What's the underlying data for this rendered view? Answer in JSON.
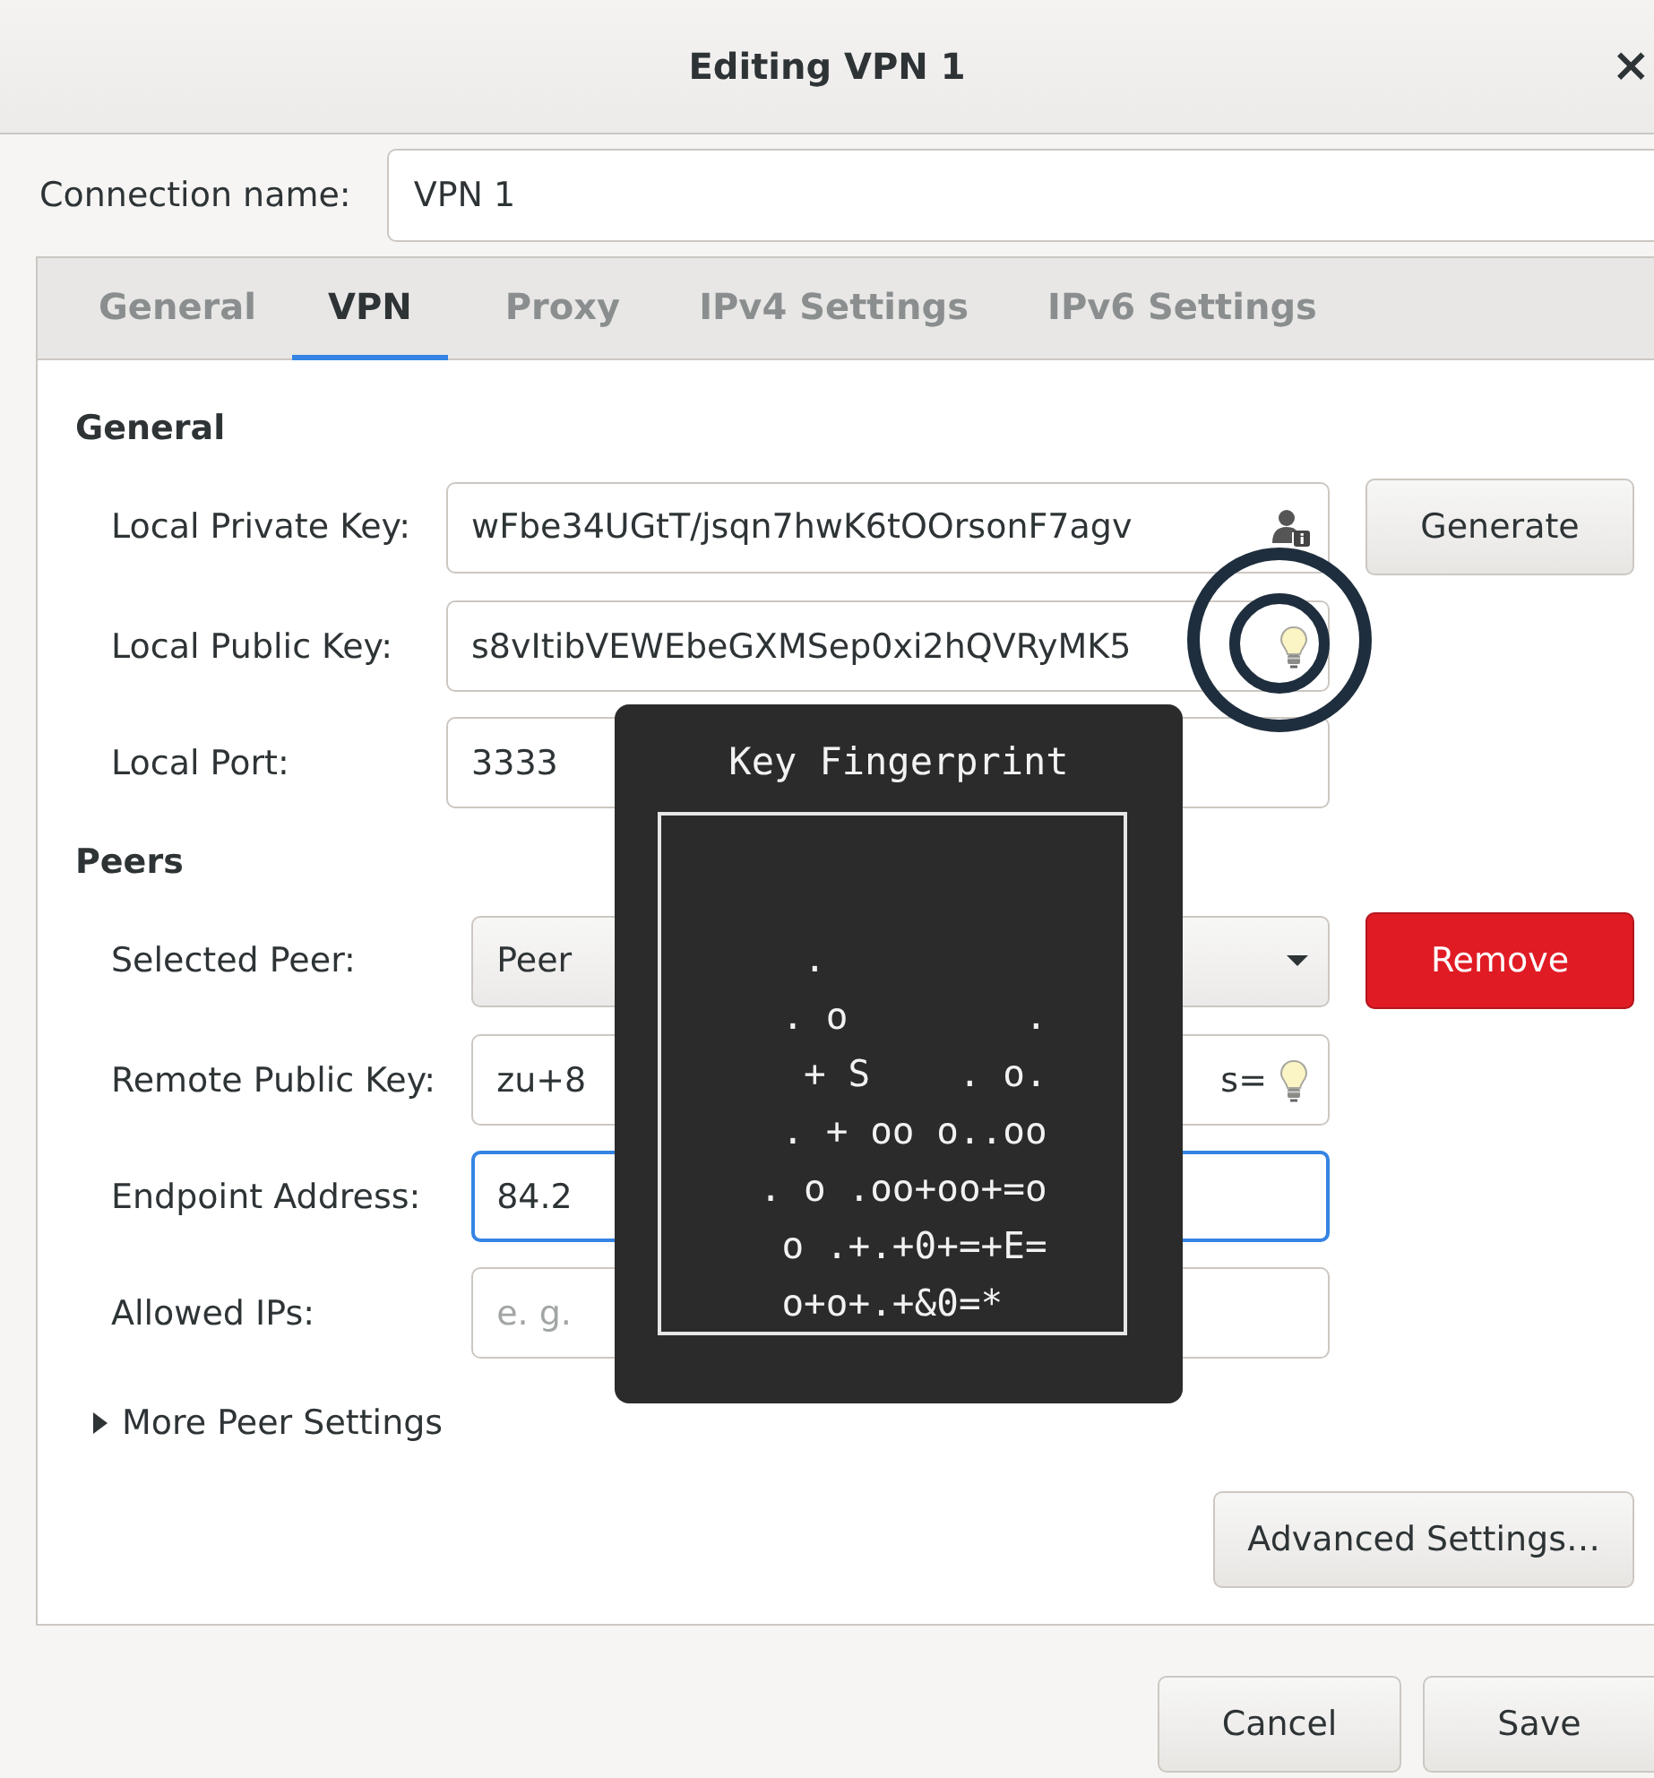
{
  "window": {
    "title": "Editing VPN 1",
    "close": "×"
  },
  "connection_name": {
    "label": "Connection name:",
    "value": "VPN 1"
  },
  "tabs": [
    {
      "label": "General",
      "selected": false
    },
    {
      "label": "VPN",
      "selected": true
    },
    {
      "label": "Proxy",
      "selected": false
    },
    {
      "label": "IPv4 Settings",
      "selected": false
    },
    {
      "label": "IPv6 Settings",
      "selected": false
    }
  ],
  "sections": [
    {
      "title": "General",
      "rows": [
        {
          "kind": "private-key",
          "label": "Local Private Key:",
          "value": "wFbe34UGtT/jsqn7hwK6tOOrsonF7agv",
          "button": {
            "kind": "generate",
            "label": "Generate"
          }
        },
        {
          "kind": "public-key",
          "label": "Local Public Key:",
          "value": "s8vItibVEWEbeGXMSep0xi2hQVRyMK5"
        },
        {
          "kind": "entry",
          "label": "Local Port:",
          "value": "3333"
        }
      ]
    },
    {
      "title": "Peers",
      "rows": [
        {
          "kind": "dropdown",
          "label": "Selected Peer:",
          "value": "Peer",
          "button": {
            "kind": "remove",
            "label": "Remove"
          }
        },
        {
          "kind": "public-key",
          "label": "Remote Public Key:",
          "value": "zu+8",
          "value_tail": "s="
        },
        {
          "kind": "entry",
          "label": "Endpoint Address:",
          "value": "84.2",
          "focused": true
        },
        {
          "kind": "entry",
          "label": "Allowed IPs:",
          "placeholder": "e. g."
        }
      ]
    }
  ],
  "expander": {
    "label": "More Peer Settings",
    "expanded": false
  },
  "advanced_button": "Advanced Settings…",
  "footer_buttons": [
    "Cancel",
    "Save"
  ],
  "tooltip": {
    "title": "Key Fingerprint",
    "art": "\n\n      .\n     . o        .\n      + S    . o.\n     . + oo o..oo\n    . o .oo+oo+=o\n     o .+.+0+=+E=\n     o+o+.+&0=*\n"
  }
}
